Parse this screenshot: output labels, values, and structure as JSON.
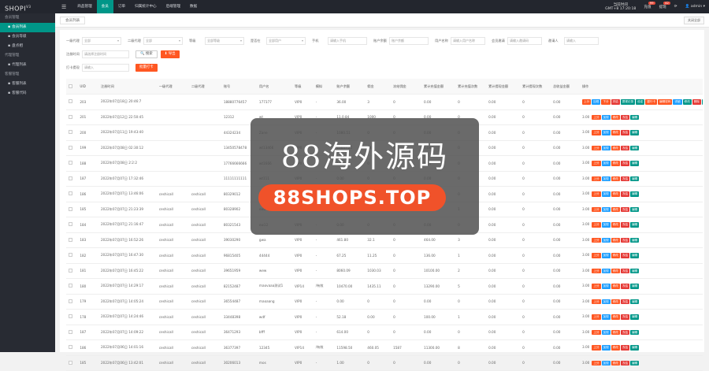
{
  "app": {
    "logo": "SHOPI",
    "version": "V3"
  },
  "sidebar": [
    {
      "group": "会员管理",
      "items": [
        {
          "label": "会员列表",
          "icon": "user-icon",
          "active": true
        },
        {
          "label": "会员等级",
          "icon": "gear-icon",
          "active": false
        },
        {
          "label": "盘点相",
          "icon": "edit-icon",
          "active": false
        }
      ]
    },
    {
      "group": "代理管理",
      "items": [
        {
          "label": "代理列表",
          "icon": "gear-icon",
          "active": false
        }
      ]
    },
    {
      "group": "客服管理",
      "items": [
        {
          "label": "客服列表",
          "icon": "people-icon",
          "active": false
        },
        {
          "label": "客服代码",
          "icon": "code-icon",
          "active": false
        }
      ]
    }
  ],
  "topbar": {
    "menus": [
      {
        "label": "商品管理",
        "active": false
      },
      {
        "label": "会员",
        "active": true
      },
      {
        "label": "订单",
        "active": false
      },
      {
        "label": "归属统计中心",
        "active": false
      },
      {
        "label": "后端管理",
        "active": false
      },
      {
        "label": "数据",
        "active": false
      }
    ],
    "time_label": "当前时间",
    "time_value": "GMT+8 17:20:18",
    "recharge": "充值",
    "recharge_badge": "99",
    "withdraw": "提现",
    "withdraw_badge": "42",
    "admin": "admin"
  },
  "tabs": {
    "current": "会员列表",
    "close_label": "关闭全部"
  },
  "filters": {
    "row1": [
      {
        "label": "一级代理",
        "value": "全部",
        "select": true
      },
      {
        "label": "二级代理",
        "value": "全部",
        "select": true
      },
      {
        "label": "等级",
        "value": "全部等级",
        "select": true
      },
      {
        "label": "是否在",
        "value": "全部用户",
        "select": true
      },
      {
        "label": "手机",
        "value": "请输入手机",
        "select": false
      },
      {
        "label": "账户余额",
        "value": "账户余额",
        "select": false
      },
      {
        "label": "用户名称",
        "value": "请输入用户名称",
        "select": false
      },
      {
        "label": "会员邀请",
        "value": "请输入邀请码",
        "select": false
      },
      {
        "label": "邀请人",
        "value": "请输入",
        "select": false
      }
    ],
    "row2_label": "注册时间",
    "row2_placeholder": "请选择注册时间",
    "search_btn": "搜索",
    "export_btn": "导出",
    "row3_label": "打卡提现",
    "row3_placeholder": "请输入",
    "bulk_btn": "批量打卡"
  },
  "table": {
    "headers": [
      "",
      "UID",
      "注册时间",
      "一级代理",
      "二级代理",
      "账号",
      "用户名",
      "等级",
      "模拟",
      "账户余额",
      "佣金",
      "冻结佣金",
      "累计充值金额",
      "累计充值次数",
      "累计提现金额",
      "累计提现次数",
      "总收益金额",
      "操作"
    ],
    "rows": [
      [
        "203",
        "2022年07月18日 20:46:7",
        "",
        "",
        "18880776457",
        "177377",
        "VIP0",
        "-",
        "36.00",
        "3",
        "0",
        "0.00",
        "0",
        "0.00",
        "0",
        "0.00"
      ],
      [
        "201",
        "2022年07月12日 22:50:45",
        "",
        "",
        "12312",
        "wt",
        "VIP0",
        "-",
        "11.0.84",
        "1000",
        "0",
        "0.00",
        "0",
        "0.00",
        "0",
        "0.00"
      ],
      [
        "200",
        "2022年07月11日 19:43:40",
        "",
        "",
        "44324234",
        "Zane",
        "VIP0",
        "-",
        "1080.51",
        "0",
        "0",
        "0.00",
        "0",
        "0.00",
        "0",
        "0.00"
      ],
      [
        "199",
        "2022年07月08日 02:30:12",
        "",
        "",
        "13450578478",
        "wt13466",
        "VIP0",
        "-",
        "10647.21",
        "348",
        "0",
        "0.00",
        "0",
        "0.00",
        "0",
        "0.00"
      ],
      [
        "188",
        "2022年07月08日 2:2:2",
        "",
        "",
        "17766666666",
        "wt1666",
        "VIP0",
        "-",
        "14.07",
        "0",
        "0",
        "0.00",
        "0",
        "0.00",
        "0",
        "0.00"
      ],
      [
        "187",
        "2022年07月07日 17:32:46",
        "",
        "",
        "11111111111",
        "wt111",
        "VIP0",
        "-",
        "0.00",
        "0",
        "0",
        "0.00",
        "0",
        "0.00",
        "0",
        "0.00"
      ],
      [
        "186",
        "2022年07月07日 13:46:06",
        "ceshicall",
        "ceshicall",
        "80329012",
        "ew",
        "VIP0",
        "-",
        "1.00",
        "0",
        "0",
        "0.00",
        "0",
        "0.00",
        "0",
        "0.00"
      ],
      [
        "185",
        "2022年07月07日 21:23:39",
        "ceshicall",
        "ceshicall",
        "80328902",
        "ew2",
        "VIP0",
        "-",
        "100.00",
        "0",
        "0",
        "100.00",
        "1",
        "0.00",
        "0",
        "0.00"
      ],
      [
        "184",
        "2022年07月07日 21:16:47",
        "ceshicall",
        "ceshicall",
        "80321543",
        "ew12",
        "VIP0",
        "-",
        "0.00",
        "0",
        "0",
        "0.00",
        "0",
        "0.00",
        "0",
        "0.00"
      ],
      [
        "183",
        "2022年07月07日 16:52:26",
        "ceshicall",
        "ceshicall",
        "39030290",
        "gwa",
        "VIP0",
        "-",
        "461.80",
        "32.1",
        "0",
        "464.00",
        "3",
        "0.00",
        "0",
        "0.00"
      ],
      [
        "182",
        "2022年07月07日 16:47:30",
        "ceshicall",
        "ceshicall",
        "96815405",
        "44444",
        "VIP0",
        "-",
        "67.25",
        "11.25",
        "0",
        "136.00",
        "1",
        "0.00",
        "0",
        "0.00"
      ],
      [
        "181",
        "2022年07月07日 16:45:22",
        "ceshicall",
        "ceshicall",
        "39651959",
        "wew",
        "VIP0",
        "-",
        "8060.09",
        "1030.03",
        "0",
        "10100.00",
        "2",
        "0.00",
        "0",
        "0.00"
      ],
      [
        "180",
        "2022年07月07日 14:29:17",
        "ceshicall",
        "ceshicall",
        "82152487",
        "maovaaa测试1",
        "VIP14",
        "/有效",
        "10470.00",
        "1435.11",
        "0",
        "13290.00",
        "5",
        "0.00",
        "0",
        "0.00"
      ],
      [
        "179",
        "2022年07月07日 14:05:24",
        "ceshicall",
        "ceshicall",
        "36554487",
        "maoaang",
        "VIP0",
        "-",
        "0.00",
        "0",
        "0",
        "0.00",
        "0",
        "0.00",
        "0",
        "0.00"
      ],
      [
        "178",
        "2022年07月07日 14:24:46",
        "ceshicall",
        "ceshicall",
        "33448398",
        "wdf",
        "VIP0",
        "-",
        "52.18",
        "0.00",
        "0",
        "100.00",
        "1",
        "0.00",
        "0",
        "0.00"
      ],
      [
        "187",
        "2022年07月07日 14:09:22",
        "ceshicall",
        "ceshicall",
        "36471293",
        "bfff",
        "VIP0",
        "-",
        "614.00",
        "0",
        "0",
        "0.00",
        "0",
        "0.00",
        "0",
        "0.00"
      ],
      [
        "186",
        "2022年07月06日 14:01:16",
        "ceshicall",
        "ceshicall",
        "36377397",
        "12345",
        "VIP14",
        "/有效",
        "11598.50",
        "460.05",
        "1587",
        "11300.00",
        "8",
        "0.00",
        "0",
        "0.00"
      ],
      [
        "185",
        "2022年07月06日 13:42:01",
        "ceshicall",
        "ceshicall",
        "30206013",
        "mos",
        "VIP0",
        "-",
        "1.00",
        "0",
        "0",
        "0.00",
        "0",
        "0.00",
        "0",
        "0.00"
      ]
    ],
    "ops_row1": [
      {
        "label": "上分",
        "color": "#ff5722"
      },
      {
        "label": "加现",
        "color": "#1e9fff"
      },
      {
        "label": "下分",
        "color": "#ff5722"
      },
      {
        "label": "冻结",
        "color": "#e53935"
      },
      {
        "label": "提现记录",
        "color": "#009688"
      },
      {
        "label": "设定",
        "color": "#009688"
      },
      {
        "label": "银行卡",
        "color": "#ff5722"
      },
      {
        "label": "编辑密码",
        "color": "#ff5722"
      },
      {
        "label": "详细",
        "color": "#1e9fff"
      },
      {
        "label": "修改",
        "color": "#009688"
      },
      {
        "label": "删除",
        "color": "#e53935"
      },
      {
        "label": "取消拉入",
        "color": "#009688"
      }
    ],
    "ops": [
      {
        "label": "上分",
        "color": "#ff5722"
      },
      {
        "label": "加现",
        "color": "#1e9fff"
      },
      {
        "label": "修改",
        "color": "#ff5722"
      },
      {
        "label": "冻结",
        "color": "#e53935"
      },
      {
        "label": "编辑",
        "color": "#009688"
      }
    ],
    "ops_suffix": "3.00"
  },
  "watermark": {
    "title": "88海外源码",
    "url": "88SHOPS.TOP"
  }
}
